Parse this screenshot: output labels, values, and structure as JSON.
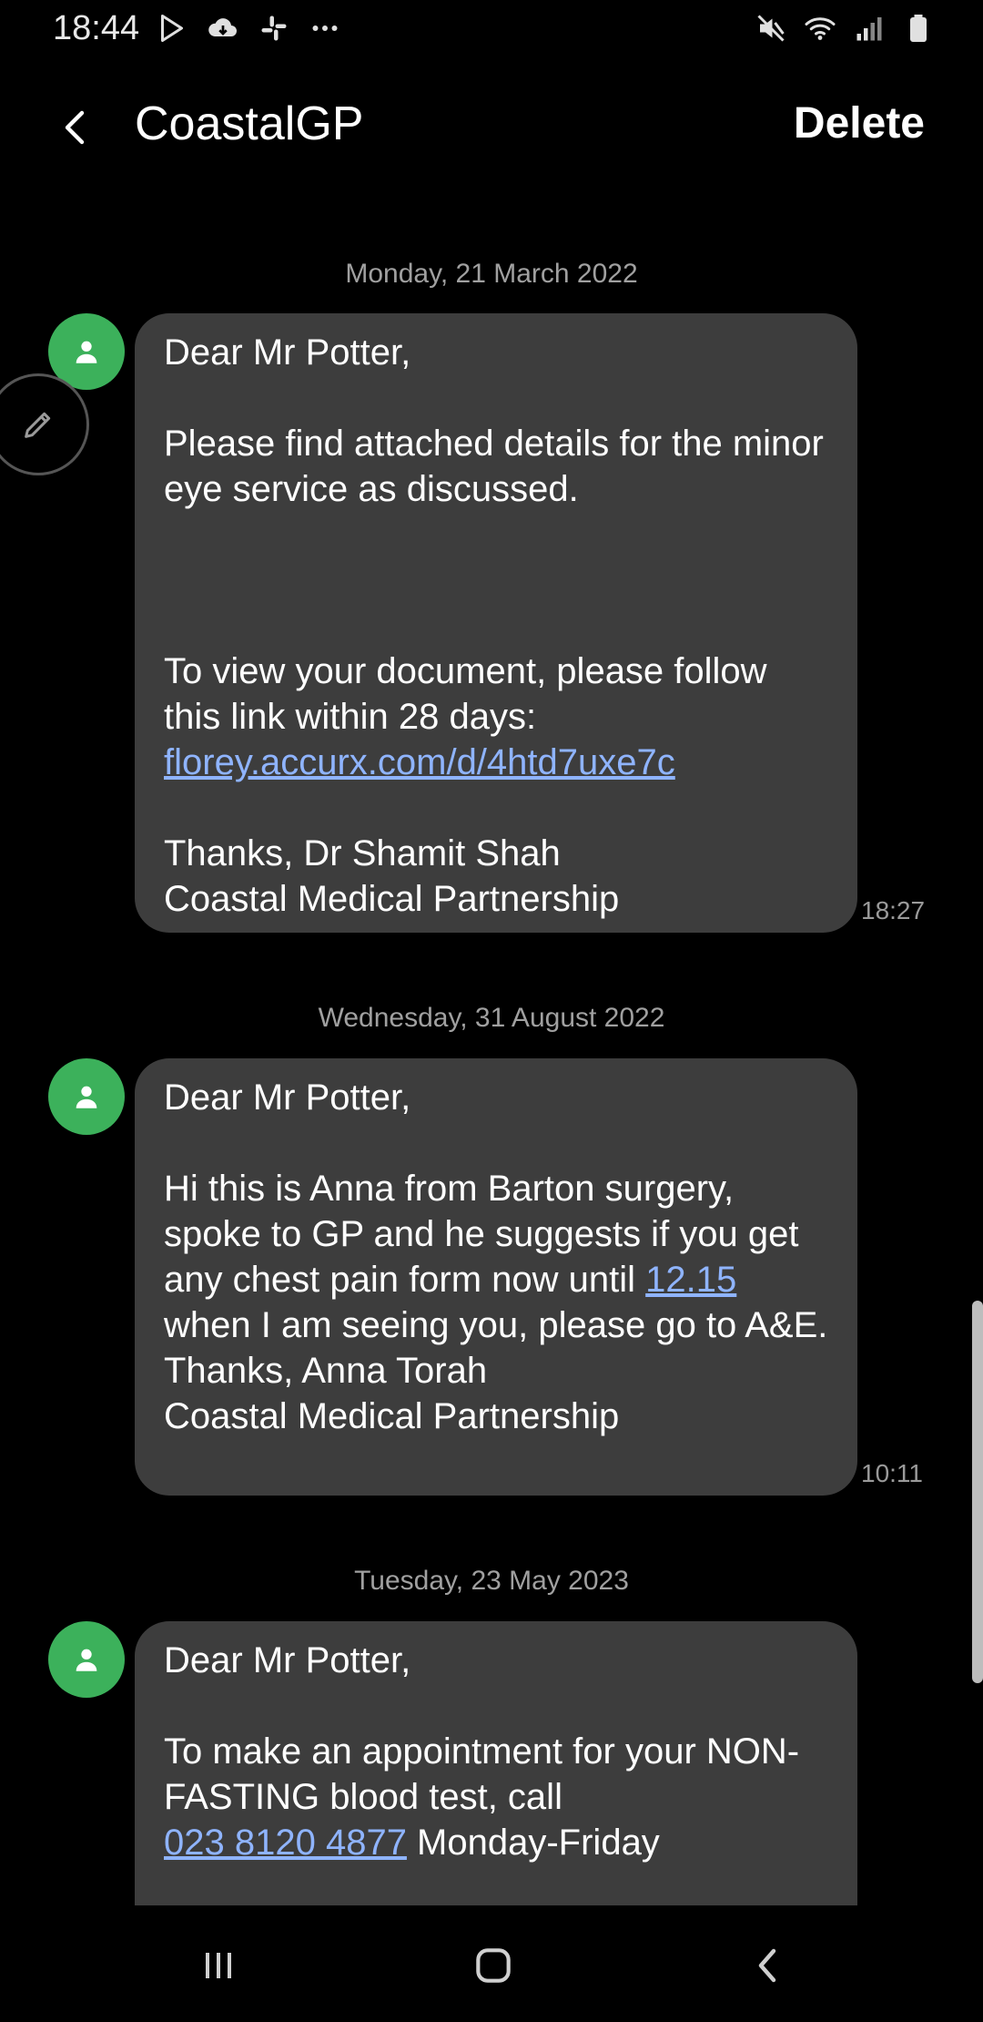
{
  "status_bar": {
    "time": "18:44",
    "left_icons": [
      "play-store-icon",
      "cloud-download-icon",
      "slack-icon",
      "more-dots-icon"
    ],
    "right_icons": [
      "mute-icon",
      "wifi-icon",
      "signal-icon",
      "battery-icon"
    ]
  },
  "header": {
    "contact": "CoastalGP",
    "delete_label": "Delete"
  },
  "messages": [
    {
      "date": "Monday, 21 March 2022",
      "time": "18:27",
      "parts": {
        "p1": "Dear Mr Potter,\n\nPlease find attached details for the minor eye service as discussed.\n\n\n\nTo view your document, please follow this link within 28 days:\n",
        "link": "florey.accurx.com/d/4htd7uxe7c",
        "p2": "\n\nThanks, Dr Shamit Shah\nCoastal Medical Partnership"
      }
    },
    {
      "date": "Wednesday, 31 August 2022",
      "time": "10:11",
      "parts": {
        "p1": "Dear Mr Potter,\n\nHi this is Anna from Barton surgery, spoke to GP and he suggests if you get any chest pain form now until ",
        "link": "12.15",
        "p2": " when I am seeing you, please go to A&E.\nThanks, Anna Torah\nCoastal Medical Partnership"
      }
    },
    {
      "date": "Tuesday, 23 May 2023",
      "time": "",
      "parts": {
        "p1": "Dear Mr Potter,\n\nTo make an appointment for your NON-FASTING blood test, call\n",
        "link": "023 8120 4877",
        "p2": " Monday-Friday"
      }
    }
  ],
  "colors": {
    "background": "#000000",
    "bubble": "#3d3d3d",
    "avatar": "#3cb15b",
    "link": "#8fb4ff",
    "secondary_text": "#a0a0a0"
  },
  "nav_bar": {
    "buttons": [
      "recent-apps-icon",
      "home-icon",
      "back-icon"
    ]
  }
}
